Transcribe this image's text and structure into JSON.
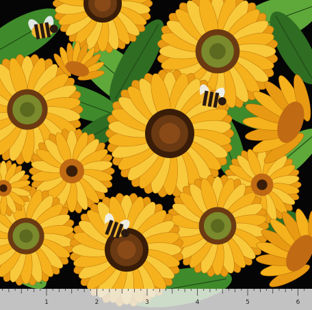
{
  "image": {
    "background_color": "#050505",
    "petal_colors": [
      "#f5b21c",
      "#f8c93a",
      "#e89a12",
      "#fcd96a"
    ],
    "center_colors": {
      "outer_brown": "#6b3a12",
      "dark_core": "#3a1d08",
      "green_core": "#7a8a2c",
      "orange_core": "#c06a14"
    },
    "leaf_colors": [
      "#3f8a2a",
      "#5fa83a",
      "#2f6d22"
    ],
    "bee_colors": {
      "stripe_yellow": "#f2b632",
      "stripe_dark": "#2a1a10",
      "wing": "#eef3f6"
    }
  },
  "ruler": {
    "background": "#ededed",
    "tick_color": "#333333",
    "labels": [
      "1",
      "2",
      "3",
      "4",
      "5",
      "6"
    ]
  }
}
